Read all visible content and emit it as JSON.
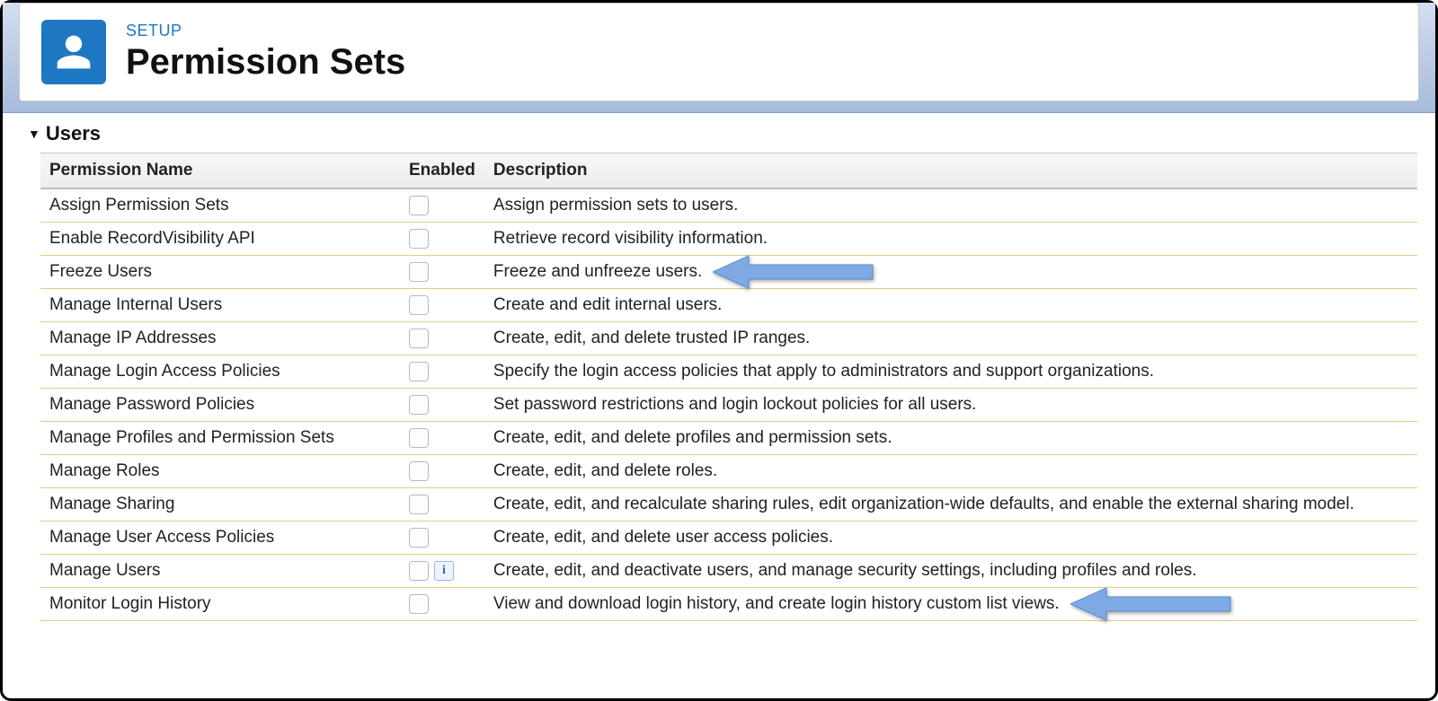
{
  "header": {
    "eyebrow": "SETUP",
    "title": "Permission Sets"
  },
  "section": {
    "title": "Users"
  },
  "table": {
    "headers": {
      "name": "Permission Name",
      "enabled": "Enabled",
      "description": "Description"
    },
    "rows": [
      {
        "name": "Assign Permission Sets",
        "enabled": false,
        "info": false,
        "description": "Assign permission sets to users."
      },
      {
        "name": "Enable RecordVisibility API",
        "enabled": false,
        "info": false,
        "description": "Retrieve record visibility information."
      },
      {
        "name": "Freeze Users",
        "enabled": false,
        "info": false,
        "description": "Freeze and unfreeze users.",
        "arrow": true
      },
      {
        "name": "Manage Internal Users",
        "enabled": false,
        "info": false,
        "description": "Create and edit internal users."
      },
      {
        "name": "Manage IP Addresses",
        "enabled": false,
        "info": false,
        "description": "Create, edit, and delete trusted IP ranges."
      },
      {
        "name": "Manage Login Access Policies",
        "enabled": false,
        "info": false,
        "description": "Specify the login access policies that apply to administrators and support organizations."
      },
      {
        "name": "Manage Password Policies",
        "enabled": false,
        "info": false,
        "description": "Set password restrictions and login lockout policies for all users."
      },
      {
        "name": "Manage Profiles and Permission Sets",
        "enabled": false,
        "info": false,
        "description": "Create, edit, and delete profiles and permission sets."
      },
      {
        "name": "Manage Roles",
        "enabled": false,
        "info": false,
        "description": "Create, edit, and delete roles."
      },
      {
        "name": "Manage Sharing",
        "enabled": false,
        "info": false,
        "description": "Create, edit, and recalculate sharing rules, edit organization-wide defaults, and enable the external sharing model."
      },
      {
        "name": "Manage User Access Policies",
        "enabled": false,
        "info": false,
        "description": "Create, edit, and delete user access policies."
      },
      {
        "name": "Manage Users",
        "enabled": false,
        "info": true,
        "description": "Create, edit, and deactivate users, and manage security settings, including profiles and roles."
      },
      {
        "name": "Monitor Login History",
        "enabled": false,
        "info": false,
        "description": "View and download login history, and create login history custom list views.",
        "arrow": true
      }
    ]
  },
  "colors": {
    "accent": "#1e77c3",
    "arrow": "#7fa9e5"
  }
}
